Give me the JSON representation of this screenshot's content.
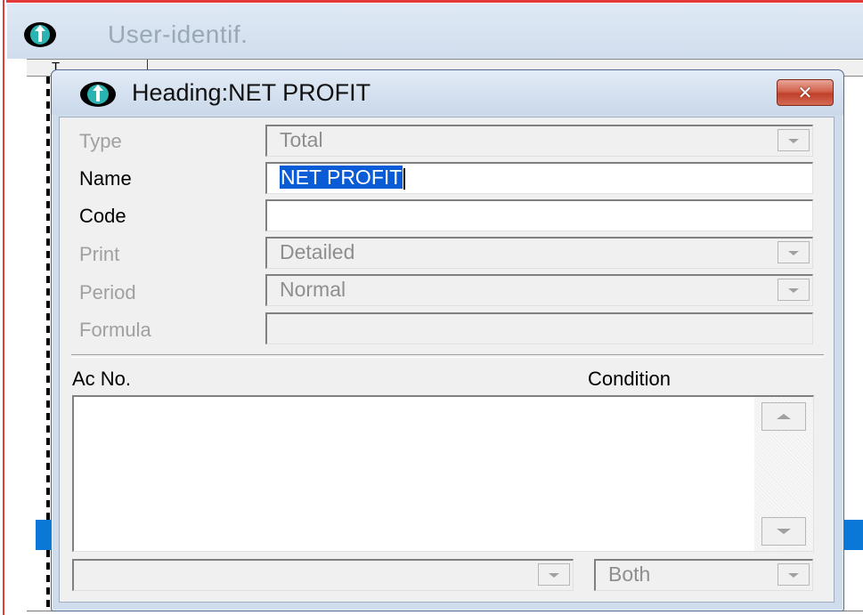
{
  "parent_window": {
    "title": "User-identif.",
    "column_header_fragment": "T"
  },
  "dialog": {
    "title": "Heading:NET PROFIT",
    "close_glyph": "✕",
    "fields": {
      "type": {
        "label": "Type",
        "value": "Total"
      },
      "name": {
        "label": "Name",
        "value": "NET PROFIT"
      },
      "code": {
        "label": "Code",
        "value": ""
      },
      "print": {
        "label": "Print",
        "value": "Detailed"
      },
      "period": {
        "label": "Period",
        "value": "Normal"
      },
      "formula": {
        "label": "Formula",
        "value": ""
      }
    },
    "list": {
      "col_ac_no": "Ac No.",
      "col_condition": "Condition",
      "rows": []
    },
    "bottom": {
      "account_combo_value": "",
      "condition_combo_value": "Both"
    }
  },
  "colors": {
    "selection_blue": "#0a5bd6",
    "close_red": "#c0412a",
    "title_bar": "#cfdcec",
    "disabled_text": "#a0a0a0",
    "parent_row_highlight": "#0a78d7",
    "left_border_red": "#e53a3a"
  },
  "icons": {
    "app_icon": "info-circle-icon",
    "close_icon": "close-icon",
    "dropdown_icon": "chevron-down-icon",
    "scroll_up_icon": "scroll-up-icon",
    "scroll_down_icon": "scroll-down-icon"
  }
}
